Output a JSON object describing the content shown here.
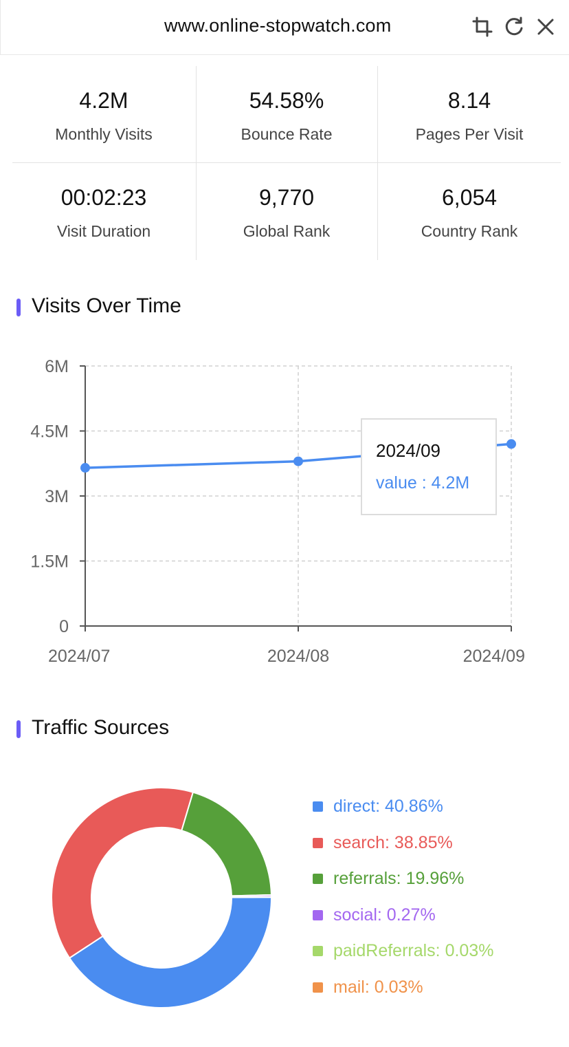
{
  "header": {
    "title": "www.online-stopwatch.com",
    "icons": [
      "crop-icon",
      "refresh-icon",
      "close-icon"
    ]
  },
  "stats": [
    {
      "value": "4.2M",
      "label": "Monthly Visits"
    },
    {
      "value": "54.58%",
      "label": "Bounce Rate"
    },
    {
      "value": "8.14",
      "label": "Pages Per Visit"
    },
    {
      "value": "00:02:23",
      "label": "Visit Duration"
    },
    {
      "value": "9,770",
      "label": "Global Rank"
    },
    {
      "value": "6,054",
      "label": "Country Rank"
    }
  ],
  "visits_section": {
    "title": "Visits Over Time"
  },
  "traffic_section": {
    "title": "Traffic Sources"
  },
  "accent_color": "#6b5cf6",
  "chart_data": [
    {
      "type": "line",
      "title": "",
      "x": [
        "2024/07",
        "2024/08",
        "2024/09"
      ],
      "values": [
        3650000,
        3800000,
        4200000
      ],
      "y_ticks": [
        "0",
        "1.5M",
        "3M",
        "4.5M",
        "6M"
      ],
      "ylim": [
        0,
        6000000
      ],
      "grid": true,
      "color": "#4a8cf0",
      "tooltip": {
        "title": "2024/09",
        "value_text": "value : 4.2M"
      }
    },
    {
      "type": "pie",
      "donut": true,
      "slices": [
        {
          "name": "direct",
          "value": 40.86,
          "label": "direct: 40.86%",
          "color": "#4a8cf0"
        },
        {
          "name": "search",
          "value": 38.85,
          "label": "search: 38.85%",
          "color": "#e85a58"
        },
        {
          "name": "referrals",
          "value": 19.96,
          "label": "referrals: 19.96%",
          "color": "#56a03a"
        },
        {
          "name": "social",
          "value": 0.27,
          "label": "social: 0.27%",
          "color": "#a367f0"
        },
        {
          "name": "paidReferrals",
          "value": 0.03,
          "label": "paidReferrals: 0.03%",
          "color": "#a5d86a"
        },
        {
          "name": "mail",
          "value": 0.03,
          "label": "mail: 0.03%",
          "color": "#f0924a"
        }
      ],
      "legend": "right"
    }
  ]
}
